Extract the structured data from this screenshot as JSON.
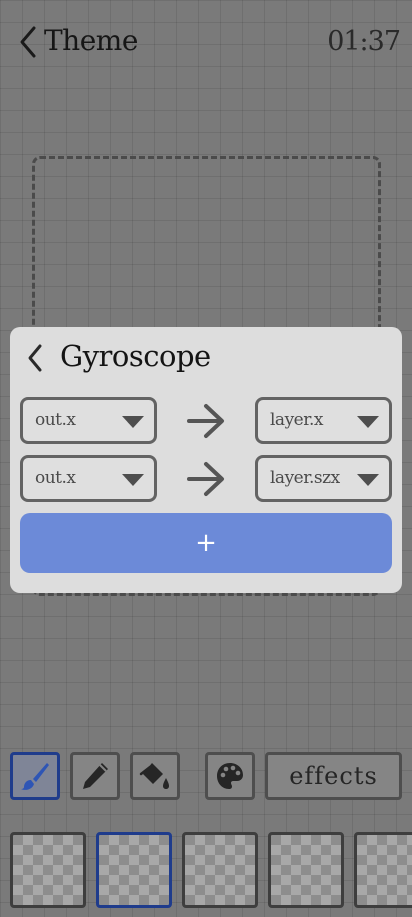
{
  "header": {
    "title": "Theme",
    "clock": "01:37"
  },
  "modal": {
    "title": "Gyroscope",
    "mappings": [
      {
        "source": "out.x",
        "target": "layer.x"
      },
      {
        "source": "out.x",
        "target": "layer.szx"
      }
    ],
    "add_label": "+"
  },
  "toolbar": {
    "tools": [
      "brush-icon",
      "pencil-icon",
      "paint-bucket-icon",
      "palette-icon"
    ],
    "active_tool": "brush-icon",
    "effects_label": "effects"
  },
  "layers": {
    "count_visible": 5,
    "selected_index": 1
  },
  "colors": {
    "accent": "#6c8ad8",
    "selected_border": "#1f3c8c",
    "modal_bg": "#dddddd",
    "background": "#7a7a7a"
  }
}
